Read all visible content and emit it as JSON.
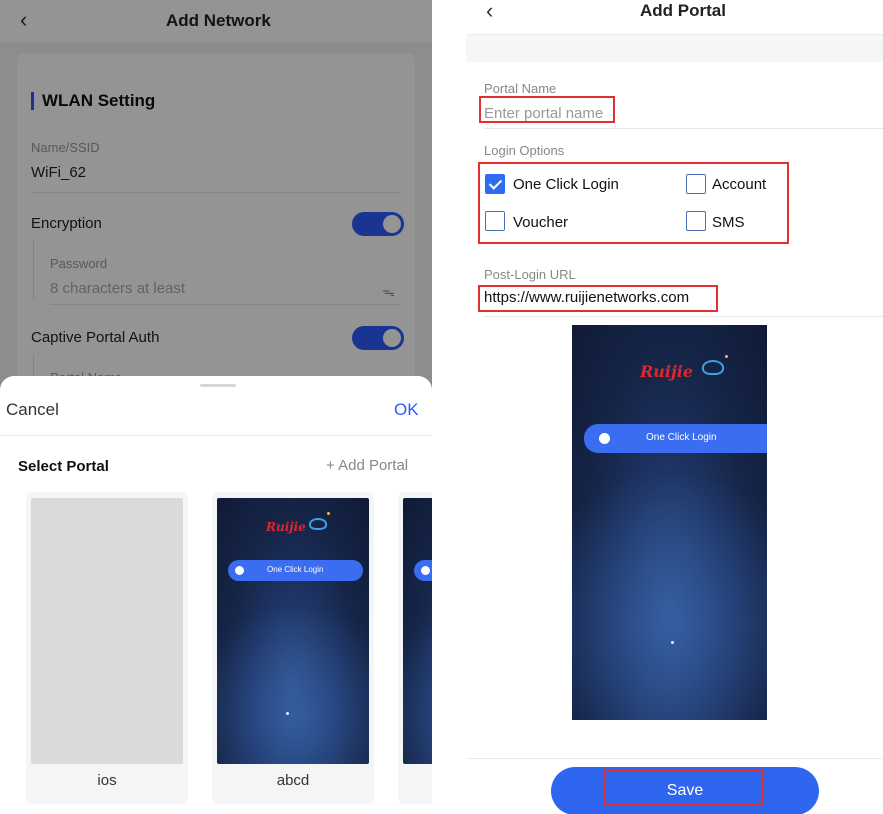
{
  "left": {
    "header": {
      "back_icon": "chevron-left-icon",
      "back_glyph": "‹",
      "title": "Add Network"
    },
    "wlan": {
      "section_title": "WLAN Setting",
      "ssid_label": "Name/SSID",
      "ssid_value": "WiFi_62",
      "encryption_label": "Encryption",
      "encryption_on": true,
      "password_label": "Password",
      "password_placeholder": "8 characters at least",
      "eye_icon": "eye-closed-icon",
      "eye_glyph": "ᯓ",
      "portal_auth_label": "Captive Portal Auth",
      "portal_auth_on": true,
      "portal_name_label": "Portal Name"
    },
    "sheet": {
      "cancel": "Cancel",
      "ok": "OK",
      "title": "Select Portal",
      "add_portal": "+ Add Portal",
      "portals": [
        {
          "name": "ios"
        },
        {
          "name": "abcd",
          "brand": "Ruijie",
          "button": "One Click Login"
        }
      ]
    }
  },
  "right": {
    "header": {
      "back_icon": "chevron-left-icon",
      "back_glyph": "‹",
      "title": "Add Portal"
    },
    "portal_name_label": "Portal Name",
    "portal_name_placeholder": "Enter portal name",
    "login_options_label": "Login Options",
    "options": [
      {
        "label": "One Click Login",
        "checked": true
      },
      {
        "label": "Account",
        "checked": false
      },
      {
        "label": "Voucher",
        "checked": false
      },
      {
        "label": "SMS",
        "checked": false
      }
    ],
    "post_login_label": "Post-Login URL",
    "post_login_value": "https://www.ruijienetworks.com",
    "preview": {
      "brand": "Ruijie",
      "button": "One Click Login"
    },
    "save": "Save"
  },
  "colors": {
    "accent": "#2e5bff",
    "highlight": "#e23030",
    "brand_red": "#e0262d"
  }
}
